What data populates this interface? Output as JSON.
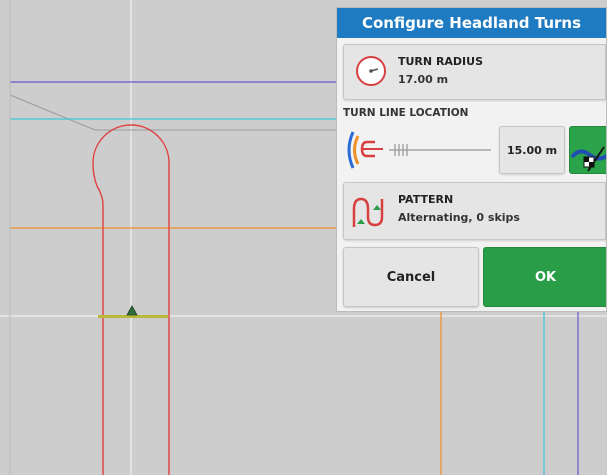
{
  "dialog": {
    "title": "Configure Headland Turns",
    "turn_radius": {
      "label": "TURN RADIUS",
      "value": "17.00 m",
      "icon": "turn-radius-icon"
    },
    "turn_line": {
      "section_label": "TURN LINE LOCATION",
      "value": "15.00 m",
      "icon": "turn-line-location-icon"
    },
    "pattern": {
      "label": "PATTERN",
      "value": "Alternating, 0 skips",
      "icon": "turn-pattern-icon"
    },
    "cancel_label": "Cancel",
    "ok_label": "OK"
  },
  "colors": {
    "title_bar": "#1e7bc1",
    "ok": "#2a9d48",
    "map_background": "#cdcdcd",
    "turn_path": "#e04040",
    "headland_orange": "#f0902a",
    "headland_cyan": "#3cc8d8",
    "boundary_purple": "#6a5acd",
    "implement_bar": "#b8b83a"
  }
}
